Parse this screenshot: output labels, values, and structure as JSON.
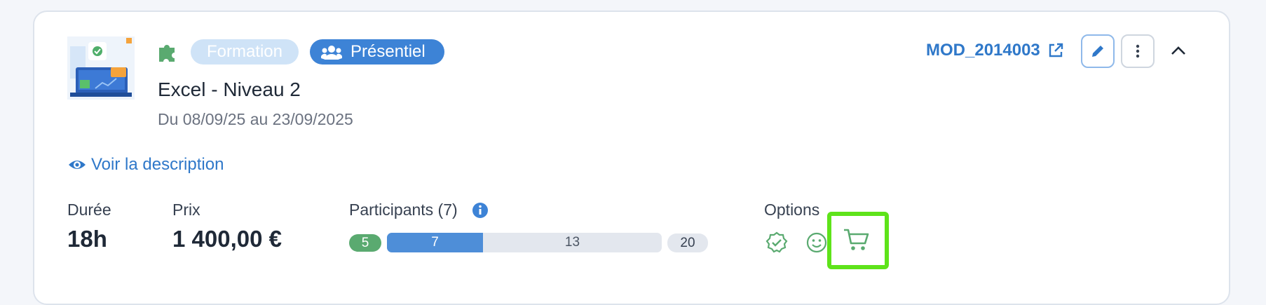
{
  "module": {
    "tags": [
      "Formation",
      "Présentiel"
    ],
    "title": "Excel - Niveau 2",
    "dates": "Du 08/09/25 au 23/09/2025",
    "reference": "MOD_2014003",
    "description_link": "Voir la description"
  },
  "stats": {
    "duration_label": "Durée",
    "duration_value": "18h",
    "price_label": "Prix",
    "price_value": "1 400,00 €",
    "participants_label": "Participants (7)",
    "participants": {
      "min": "5",
      "current": "7",
      "remaining": "13",
      "max": "20",
      "fill_fraction": 0.35
    },
    "options_label": "Options"
  },
  "icons": {
    "thumbnail": "excel-course-illustration",
    "category": "puzzle-icon",
    "presentiel": "people-icon",
    "external": "external-link-icon",
    "edit": "pencil-icon",
    "more": "kebab-icon",
    "collapse": "chevron-up-icon",
    "eye": "eye-icon",
    "info": "info-icon",
    "options": [
      "check-badge-icon",
      "smiley-icon",
      "cart-icon"
    ]
  },
  "colors": {
    "accent": "#2f78c9",
    "tag_light": "#cfe3f7",
    "tag_dark": "#3d83d6",
    "success": "#5aaa70",
    "highlight": "#5ee31a"
  }
}
